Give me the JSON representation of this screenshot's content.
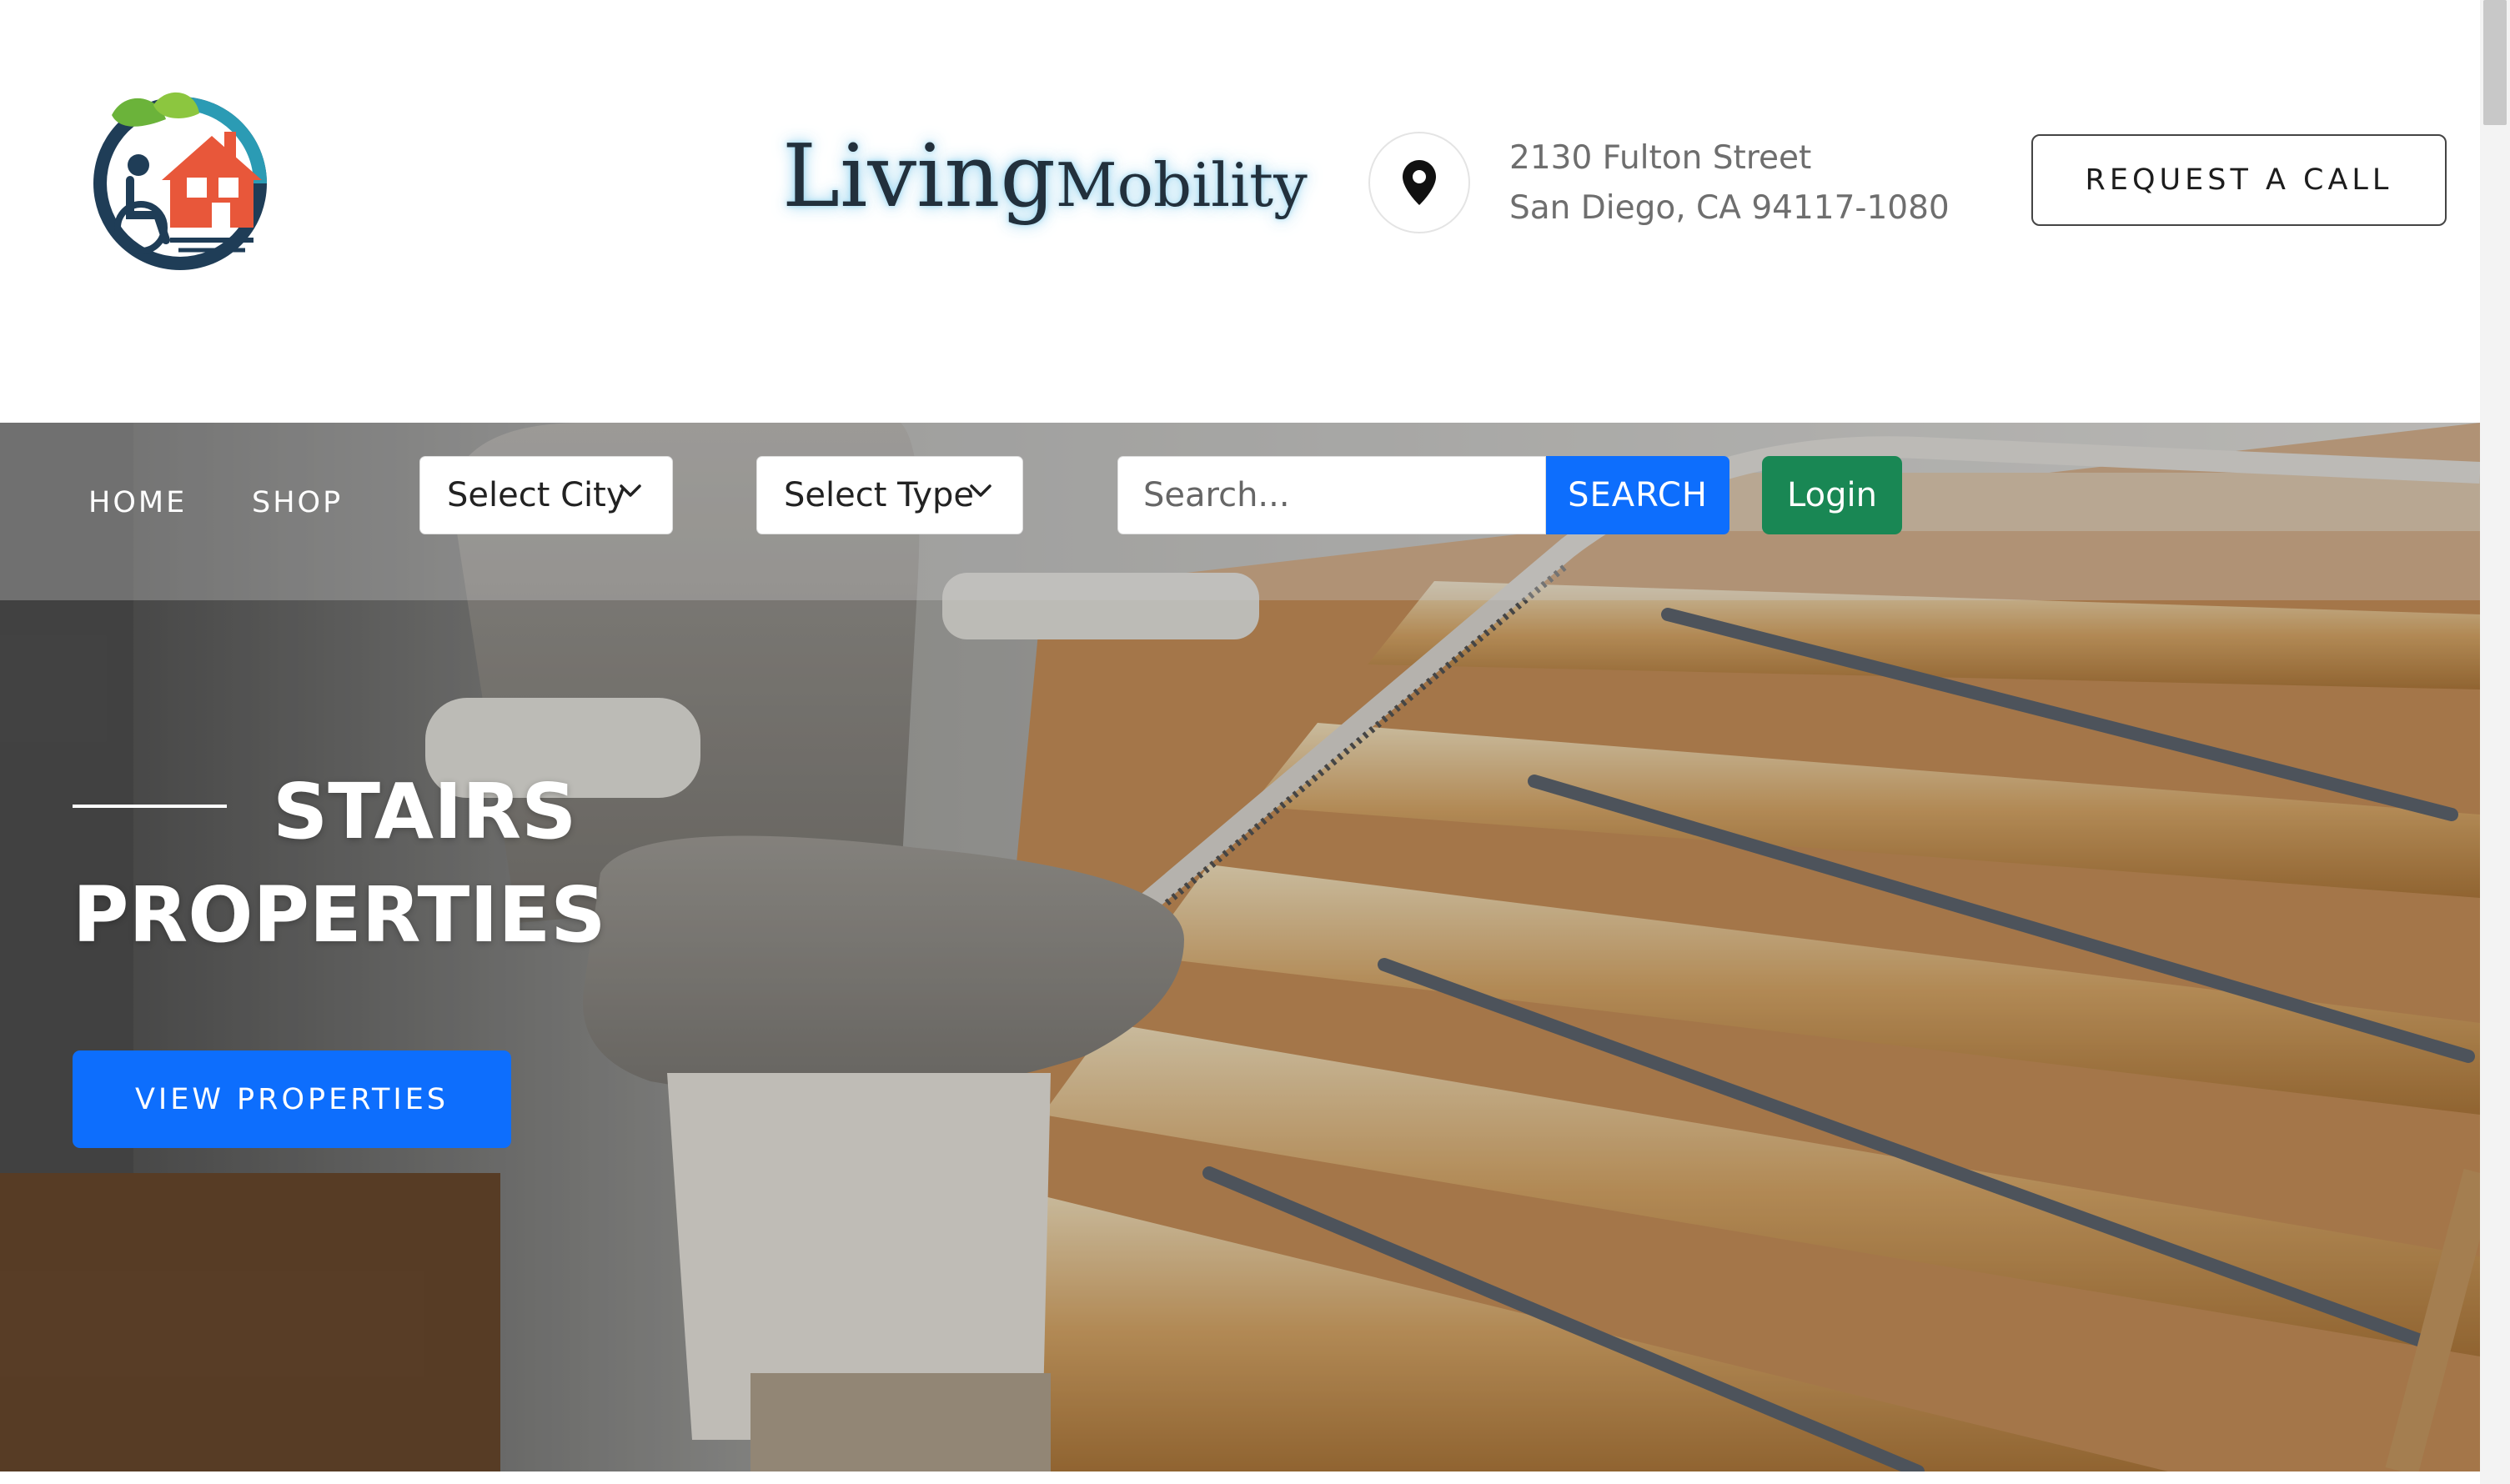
{
  "brand": {
    "name_part1": "Living",
    "name_part2": "Mobility"
  },
  "header": {
    "address_line1": "2130 Fulton Street",
    "address_line2": "San Diego, CA 94117-1080",
    "request_call_label": "REQUEST A CALL"
  },
  "nav": {
    "home_label": "HOME",
    "shop_label": "SHOP",
    "city_select_label": "Select City",
    "type_select_label": "Select Type",
    "search_placeholder": "Search...",
    "search_button_label": "SEARCH",
    "login_label": "Login"
  },
  "hero": {
    "title_line1": "STAIRS",
    "title_line2": "PROPERTIES",
    "cta_label": "VIEW PROPERTIES"
  },
  "colors": {
    "primary_blue": "#0d6efd",
    "login_green": "#198754",
    "logo_orange": "#e8573a",
    "logo_teal": "#2b9bb4",
    "logo_navy": "#1f3d57",
    "leaf_green": "#6bb33a"
  },
  "icons": {
    "location": "map-pin-icon",
    "dropdown": "chevron-down-icon",
    "logo": "wheelchair-home-logo"
  }
}
